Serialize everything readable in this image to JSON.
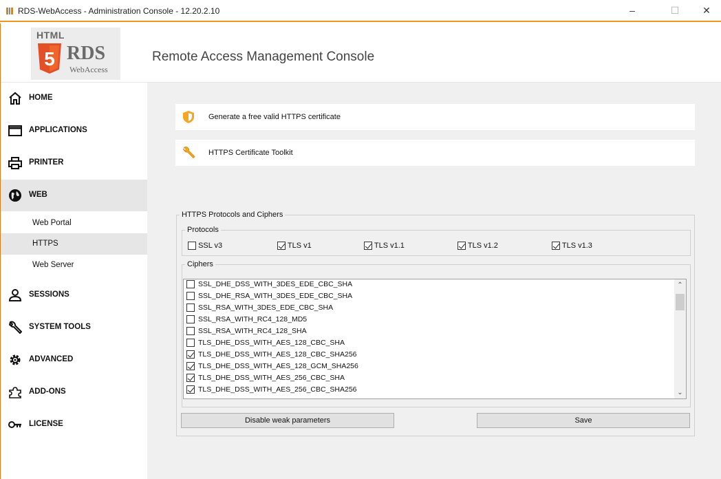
{
  "window": {
    "title": "RDS-WebAccess - Administration Console - 12.20.2.10",
    "minimize": "–",
    "maximize": "☐",
    "close": "✕"
  },
  "header": {
    "logo_html": "HTML",
    "logo_number": "5",
    "logo_rds": "RDS",
    "logo_webaccess": "WebAccess",
    "console_title": "Remote Access Management Console"
  },
  "sidebar": {
    "items": [
      {
        "label": "HOME",
        "icon": "home-icon"
      },
      {
        "label": "APPLICATIONS",
        "icon": "window-icon"
      },
      {
        "label": "PRINTER",
        "icon": "printer-icon"
      },
      {
        "label": "WEB",
        "icon": "globe-icon",
        "active": true
      },
      {
        "label": "SESSIONS",
        "icon": "user-icon"
      },
      {
        "label": "SYSTEM TOOLS",
        "icon": "wrench-icon"
      },
      {
        "label": "ADVANCED",
        "icon": "gear-icon"
      },
      {
        "label": "ADD-ONS",
        "icon": "puzzle-icon"
      },
      {
        "label": "LICENSE",
        "icon": "key-icon"
      }
    ],
    "web_subitems": [
      {
        "label": "Web Portal"
      },
      {
        "label": "HTTPS",
        "active": true
      },
      {
        "label": "Web Server"
      }
    ]
  },
  "main": {
    "cards": [
      {
        "label": "Generate a free valid HTTPS certificate",
        "icon": "shield-icon"
      },
      {
        "label": "HTTPS Certificate Toolkit",
        "icon": "tools-icon"
      }
    ],
    "https_group_title": "HTTPS Protocols and Ciphers",
    "protocols_title": "Protocols",
    "protocols": [
      {
        "label": "SSL v3",
        "checked": false
      },
      {
        "label": "TLS v1",
        "checked": true
      },
      {
        "label": "TLS v1.1",
        "checked": true
      },
      {
        "label": "TLS v1.2",
        "checked": true
      },
      {
        "label": "TLS v1.3",
        "checked": true
      }
    ],
    "ciphers_title": "Ciphers",
    "ciphers": [
      {
        "label": "SSL_DHE_DSS_WITH_3DES_EDE_CBC_SHA",
        "checked": false
      },
      {
        "label": "SSL_DHE_RSA_WITH_3DES_EDE_CBC_SHA",
        "checked": false
      },
      {
        "label": "SSL_RSA_WITH_3DES_EDE_CBC_SHA",
        "checked": false
      },
      {
        "label": "SSL_RSA_WITH_RC4_128_MD5",
        "checked": false
      },
      {
        "label": "SSL_RSA_WITH_RC4_128_SHA",
        "checked": false
      },
      {
        "label": "TLS_DHE_DSS_WITH_AES_128_CBC_SHA",
        "checked": false
      },
      {
        "label": "TLS_DHE_DSS_WITH_AES_128_CBC_SHA256",
        "checked": true
      },
      {
        "label": "TLS_DHE_DSS_WITH_AES_128_GCM_SHA256",
        "checked": true
      },
      {
        "label": "TLS_DHE_DSS_WITH_AES_256_CBC_SHA",
        "checked": true
      },
      {
        "label": "TLS_DHE_DSS_WITH_AES_256_CBC_SHA256",
        "checked": true
      }
    ],
    "disable_weak_label": "Disable weak parameters",
    "save_label": "Save"
  },
  "colors": {
    "accent_orange": "#f0961e",
    "shield_orange": "#f5a623",
    "content_bg": "#f0f0f0",
    "active_nav_bg": "#e6e6e6"
  }
}
